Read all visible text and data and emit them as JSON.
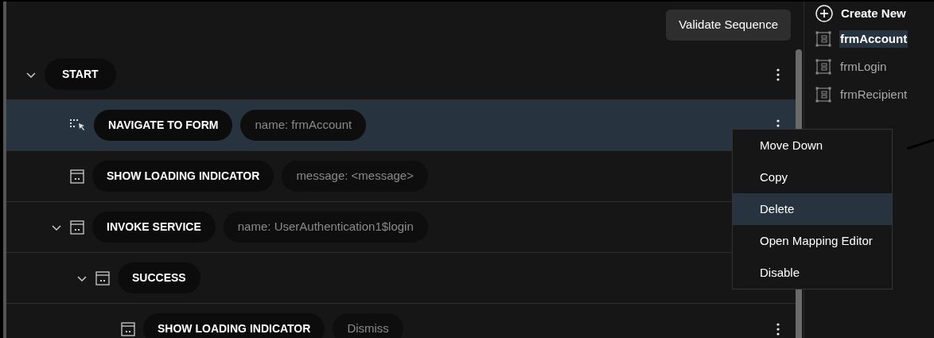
{
  "toolbar": {
    "validate_button": "Validate Sequence"
  },
  "sequence": [
    {
      "kind": "start",
      "label": "START",
      "expanded": true,
      "selected": false,
      "children": [
        {
          "kind": "navigate",
          "label": "NAVIGATE TO FORM",
          "param": "name: frmAccount",
          "selected": true
        },
        {
          "kind": "action",
          "label": "SHOW LOADING INDICATOR",
          "param": "message: <message>",
          "selected": false
        },
        {
          "kind": "action",
          "label": "INVOKE SERVICE",
          "param": "name: UserAuthentication1$login",
          "expanded": true,
          "selected": false,
          "children": [
            {
              "kind": "action",
              "label": "SUCCESS",
              "expanded": true,
              "selected": false,
              "children": [
                {
                  "kind": "action",
                  "label": "SHOW LOADING INDICATOR",
                  "param": "Dismiss",
                  "selected": false
                }
              ]
            }
          ]
        }
      ]
    }
  ],
  "context_menu": [
    {
      "label": "Move Down",
      "selected": false
    },
    {
      "label": "Copy",
      "selected": false
    },
    {
      "label": "Delete",
      "selected": true
    },
    {
      "label": "Open Mapping Editor",
      "selected": false
    },
    {
      "label": "Disable",
      "selected": false
    }
  ],
  "sidebar": {
    "create_new": "Create New",
    "forms": [
      {
        "label": "frmAccount",
        "selected": true
      },
      {
        "label": "frmLogin",
        "selected": false
      },
      {
        "label": "frmRecipient",
        "selected": false
      }
    ]
  }
}
